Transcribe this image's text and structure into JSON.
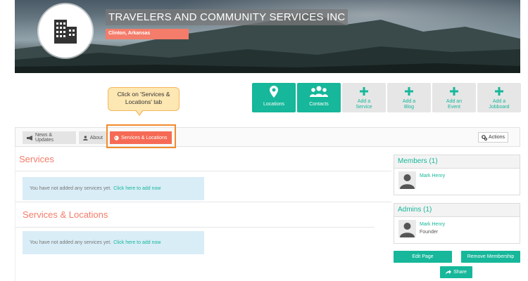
{
  "banner": {
    "org_name": "TRAVELERS AND COMMUNITY SERVICES INC",
    "location": "Clinton, Arkansas",
    "logo_icon": "building-icon"
  },
  "tiles": [
    {
      "label": "Locations",
      "icon": "map-pin-icon",
      "style": "green"
    },
    {
      "label": "Contacts",
      "icon": "users-icon",
      "style": "green"
    },
    {
      "label": "Add a\nService",
      "icon": "plus-icon",
      "style": "grey"
    },
    {
      "label": "Add a\nBlog",
      "icon": "plus-icon",
      "style": "grey"
    },
    {
      "label": "Add an\nEvent",
      "icon": "plus-icon",
      "style": "grey"
    },
    {
      "label": "Add a\nJobboard",
      "icon": "plus-icon",
      "style": "grey"
    }
  ],
  "callout": {
    "line1": "Click on 'Services &",
    "line2": "Locations' tab"
  },
  "tabs": {
    "news": "News & Updates",
    "about": "About",
    "services": "Services & Locations",
    "actions": "Actions"
  },
  "main": {
    "services_title": "Services",
    "services_locations_title": "Services & Locations",
    "empty_text": "You have not added any services yet.",
    "add_link": "Click here to add now"
  },
  "sidebar": {
    "members_title": "Members (1)",
    "admins_title": "Admins (1)",
    "member_name": "Mark Henry",
    "admin_name": "Mark Henry",
    "admin_role": "Founder",
    "edit_page": "Edit Page",
    "remove_membership": "Remove Membership",
    "share": "Share"
  },
  "colors": {
    "accent": "#16b79a",
    "tab_active": "#f66a55",
    "title": "#f47c6a"
  }
}
